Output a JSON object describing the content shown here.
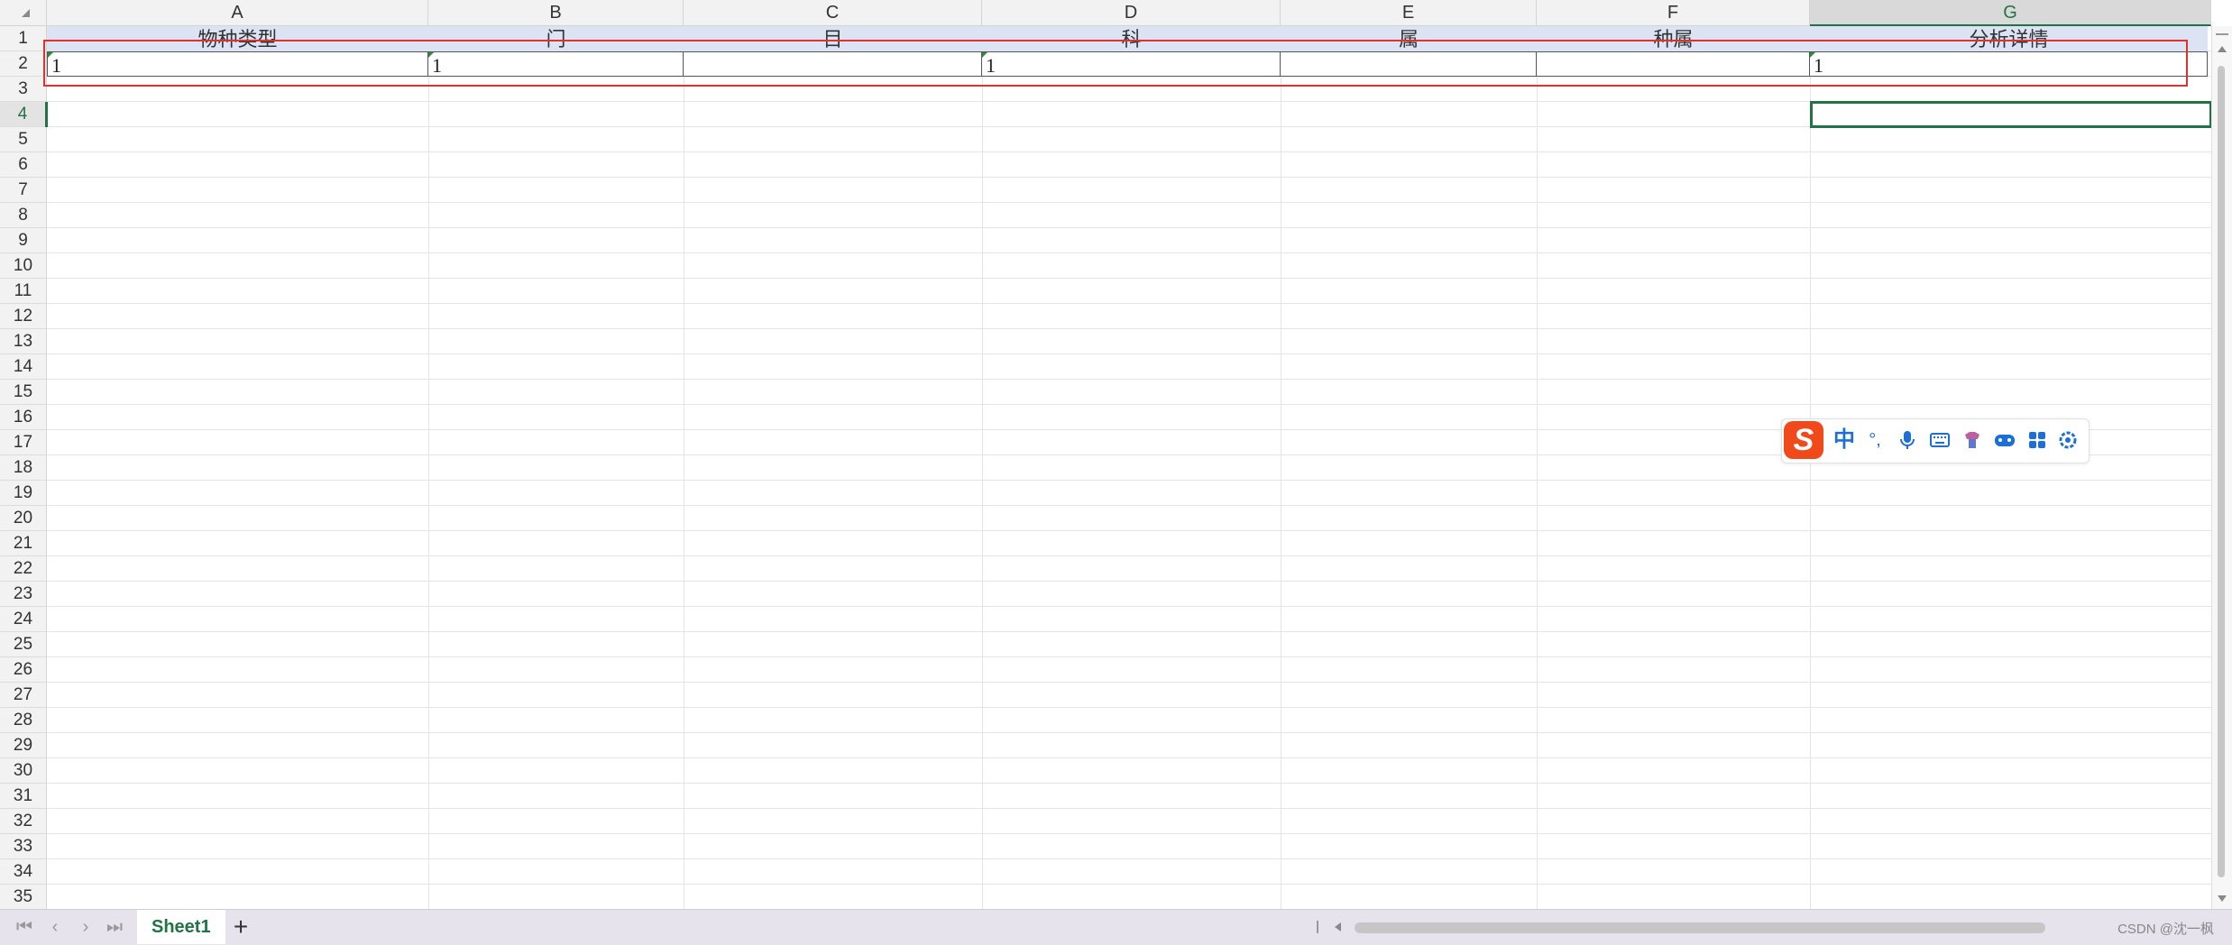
{
  "columns": [
    "A",
    "B",
    "C",
    "D",
    "E",
    "F",
    "G"
  ],
  "selected_column": "G",
  "row_numbers": [
    "1",
    "2",
    "3",
    "4",
    "5",
    "6",
    "7",
    "8",
    "9",
    "10",
    "11",
    "12",
    "13",
    "14",
    "15",
    "16",
    "17",
    "18",
    "19",
    "20",
    "21",
    "22",
    "23",
    "24",
    "25",
    "26",
    "27",
    "28",
    "29",
    "30",
    "31",
    "32",
    "33",
    "34",
    "35"
  ],
  "selected_row": "4",
  "header_row": [
    "物种类型",
    "门",
    "目",
    "科",
    "属",
    "种属",
    "分析详情"
  ],
  "data_row": [
    "1",
    "1",
    "",
    "1",
    "",
    "",
    "1"
  ],
  "sheet_tab": {
    "label": "Sheet1",
    "add": "+"
  },
  "nav_buttons": [
    "⏮",
    "‹",
    "›",
    "⏭"
  ],
  "watermark": "CSDN @沈一枫",
  "ime": {
    "logo": "S",
    "lang": "中",
    "punct": "°,",
    "icons": [
      "microphone-icon",
      "keyboard-icon",
      "skin-icon",
      "gamepad-icon",
      "apps-grid-icon",
      "settings-icon"
    ]
  },
  "colors": {
    "accent": "#217346",
    "highlight_box": "#e03030",
    "header_band": "#dce4f3",
    "ime_logo": "#f04a1a"
  }
}
